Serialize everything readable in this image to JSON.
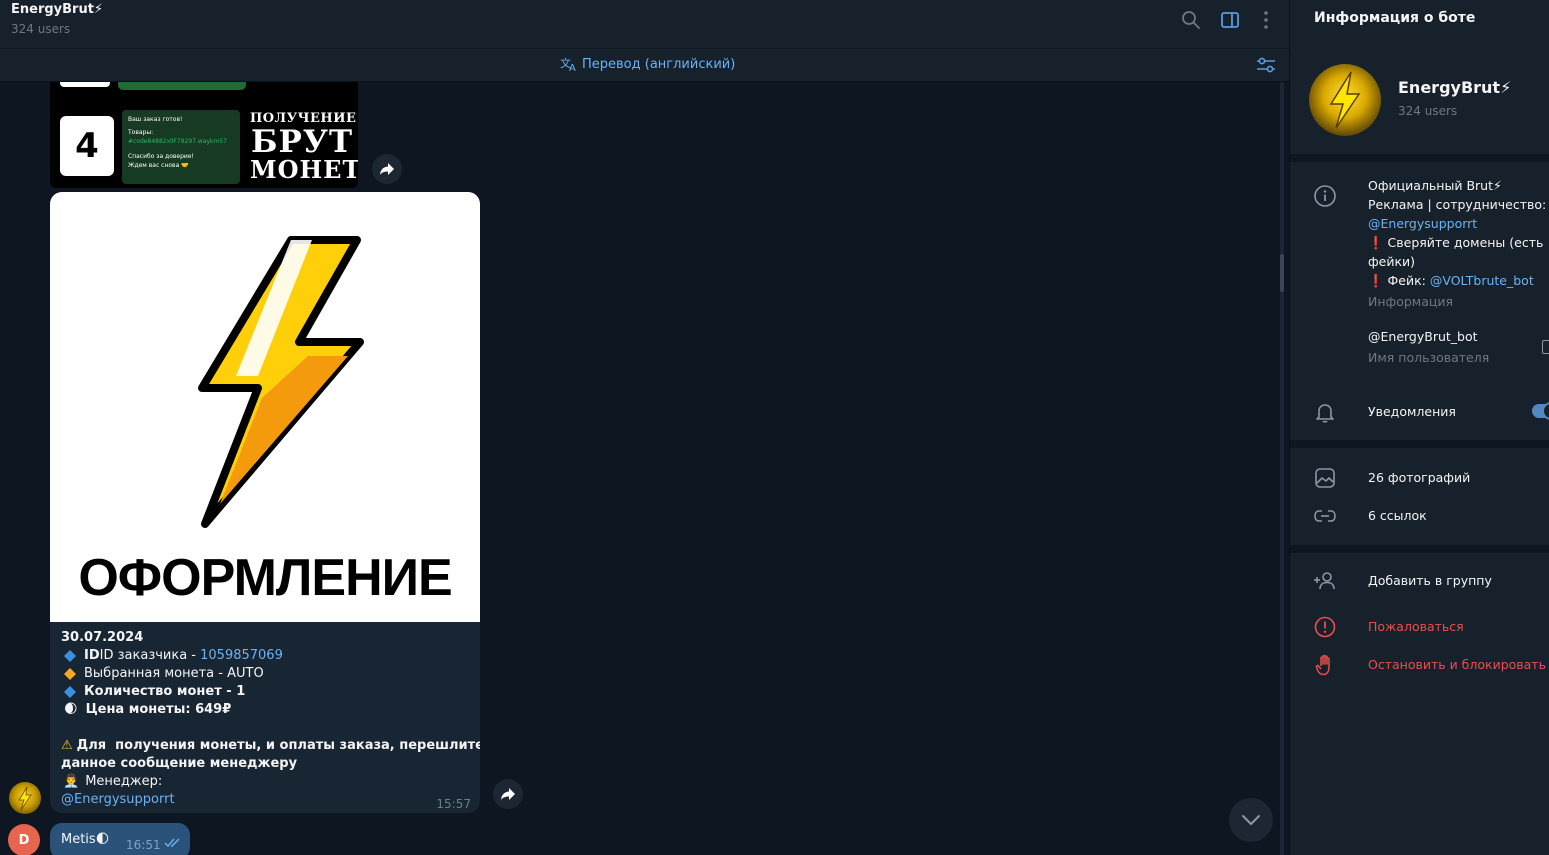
{
  "header": {
    "title": "EnergyBrut⚡",
    "subtitle": "324 users",
    "translate_label": "Перевод (английский)"
  },
  "chat": {
    "top_image": {
      "number": "4",
      "phone_line1": "Ваш заказ готов!",
      "phone_line2": "Товары:",
      "phone_line3": "#code84882xllF78297.waykm57",
      "phone_line4": "Спасибо за доверие!",
      "phone_line5": "Ждем вас снова 🤝",
      "title_l1": "ПОЛУЧЕНИЕ",
      "title_l2": "БРУТ",
      "title_l3": "МОНЕТ"
    },
    "message": {
      "image_caption": "ОФОРМЛЕНИЕ",
      "date": "30.07.2024",
      "customer_id_label": "ID заказчика - ",
      "customer_id": "1059857069",
      "coin_label": "Выбранная монета - AUTO",
      "count_label": "Количество монет - 1",
      "price_label": "Цена монеты: 649₽",
      "warning_text": "Для  получения монеты, и оплаты заказа, перешлите",
      "warning_text2": "данное сообщение менеджеру",
      "manager_label": "Менеджер:",
      "manager_link": "@Energysupporrt",
      "time": "15:57"
    },
    "outgoing": {
      "avatar_letter": "D",
      "text": "Metis🌓",
      "time": "16:51"
    },
    "colors": {
      "blue_diamond": "#3d8fe0",
      "orange_diamond": "#f5a623"
    }
  },
  "panel": {
    "title": "Информация о боте",
    "bot_name": "EnergyBrut⚡",
    "bot_sub": "324 users",
    "bio_line1": "Официальный Brut⚡",
    "bio_line2": "Реклама | сотрудничество:",
    "bio_link1": "@Energysupporrt",
    "bio_line3": "❗ Сверяйте домены (есть",
    "bio_line4": "фейки)",
    "bio_line5_prefix": "❗ Фейк: ",
    "bio_link2": "@VOLTbrute_bot",
    "info_label": "Информация",
    "username": "@EnergyBrut_bot",
    "username_label": "Имя пользователя",
    "notifications": "Уведомления",
    "photos": "26 фотографий",
    "links": "6 ссылок",
    "add_to_group": "Добавить в группу",
    "report": "Пожаловаться",
    "block": "Остановить и блокировать"
  }
}
